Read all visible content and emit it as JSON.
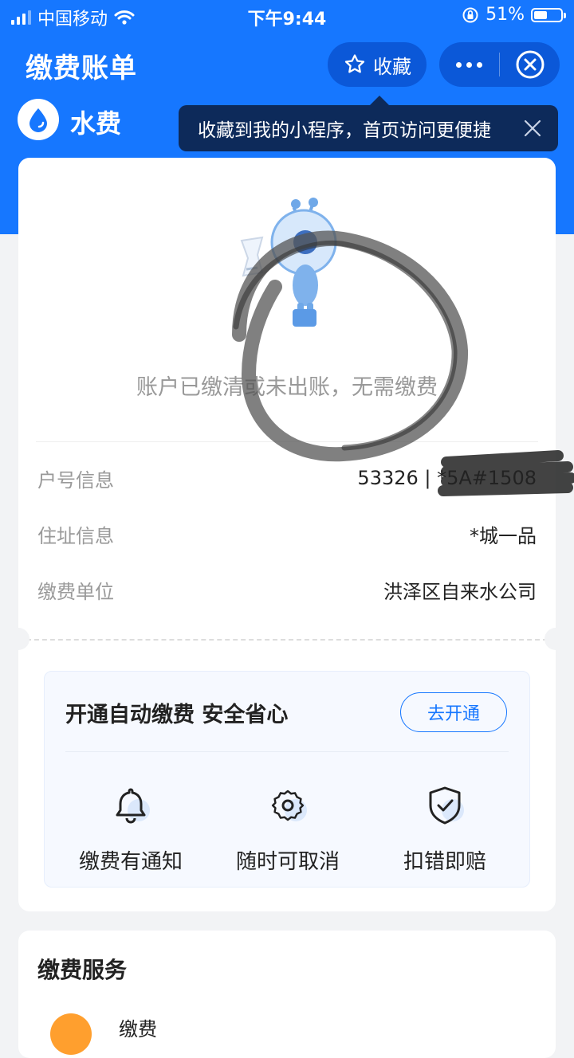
{
  "status_bar": {
    "carrier": "中国移动",
    "time": "下午9:44",
    "battery": "51%",
    "battery_level": 0.51
  },
  "header": {
    "title": "缴费账单",
    "favorite_label": "收藏"
  },
  "service": {
    "name": "水费"
  },
  "tooltip": {
    "text": "收藏到我的小程序，首页访问更便捷"
  },
  "bill": {
    "empty_message": "账户已缴清或未出账，无需缴费",
    "rows": [
      {
        "label": "户号信息",
        "value": "53326 | *5A#1508"
      },
      {
        "label": "住址信息",
        "value": "*城一品"
      },
      {
        "label": "缴费单位",
        "value": "洪泽区自来水公司"
      }
    ]
  },
  "autopay": {
    "title": "开通自动缴费 安全省心",
    "button": "去开通",
    "features": [
      {
        "label": "缴费有通知",
        "icon": "bell-icon"
      },
      {
        "label": "随时可取消",
        "icon": "gear-icon"
      },
      {
        "label": "扣错即赔",
        "icon": "shield-check-icon"
      }
    ]
  },
  "services_section": {
    "title": "缴费服务",
    "first_item": "缴费"
  },
  "colors": {
    "primary": "#1677ff",
    "header_dark": "#0b58d8",
    "tooltip_bg": "#0d2a5a",
    "page_bg": "#f2f3f5"
  }
}
